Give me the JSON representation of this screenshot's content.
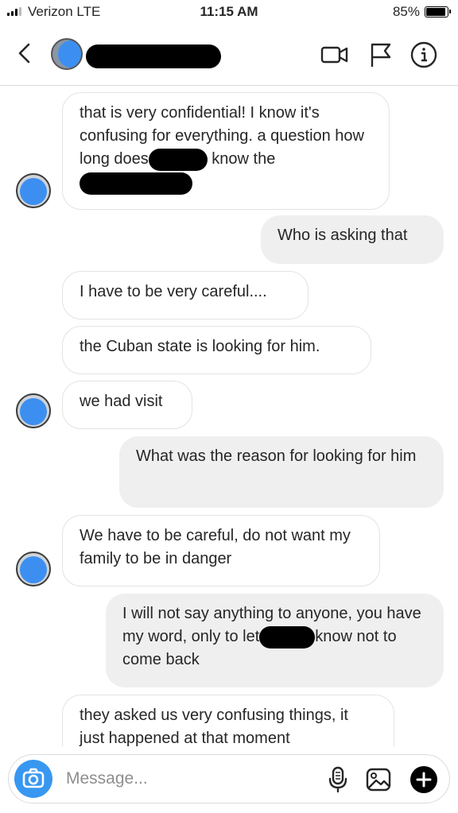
{
  "status_bar": {
    "carrier": "Verizon  LTE",
    "time": "11:15 AM",
    "battery_percent": "85%",
    "battery_level": 0.85,
    "signal_bars": 3
  },
  "header": {
    "back_icon": "chevron-left-icon",
    "name_redacted": true,
    "icons": [
      "video-camera-icon",
      "flag-icon",
      "info-icon"
    ]
  },
  "messages": [
    {
      "direction": "in",
      "text_parts": [
        "that is very confidential! I know it's confusing for everything. a question how long does",
        " know the"
      ]
    },
    {
      "direction": "out",
      "text": "Who is asking that"
    },
    {
      "direction": "in",
      "text": "I have to be very careful...."
    },
    {
      "direction": "in",
      "text": "the Cuban state is looking for him."
    },
    {
      "direction": "in",
      "text": "we had visit"
    },
    {
      "direction": "out",
      "text": "What was the reason for looking for him"
    },
    {
      "direction": "in",
      "text": "We have to be careful, do not want my family to be in danger"
    },
    {
      "direction": "out",
      "text_parts": [
        "I will not say anything to anyone, you have my word, only to let",
        "know not to come back"
      ]
    },
    {
      "direction": "in",
      "text": "they asked us very confusing things, it just happened at that moment"
    }
  ],
  "composer": {
    "placeholder": "Message...",
    "icons": [
      "camera-icon",
      "microphone-icon",
      "photo-gallery-icon",
      "plus-icon"
    ]
  },
  "colors": {
    "accent": "#3897f0",
    "outgoing_bubble": "#efefef",
    "incoming_border": "#e3e3e3"
  }
}
